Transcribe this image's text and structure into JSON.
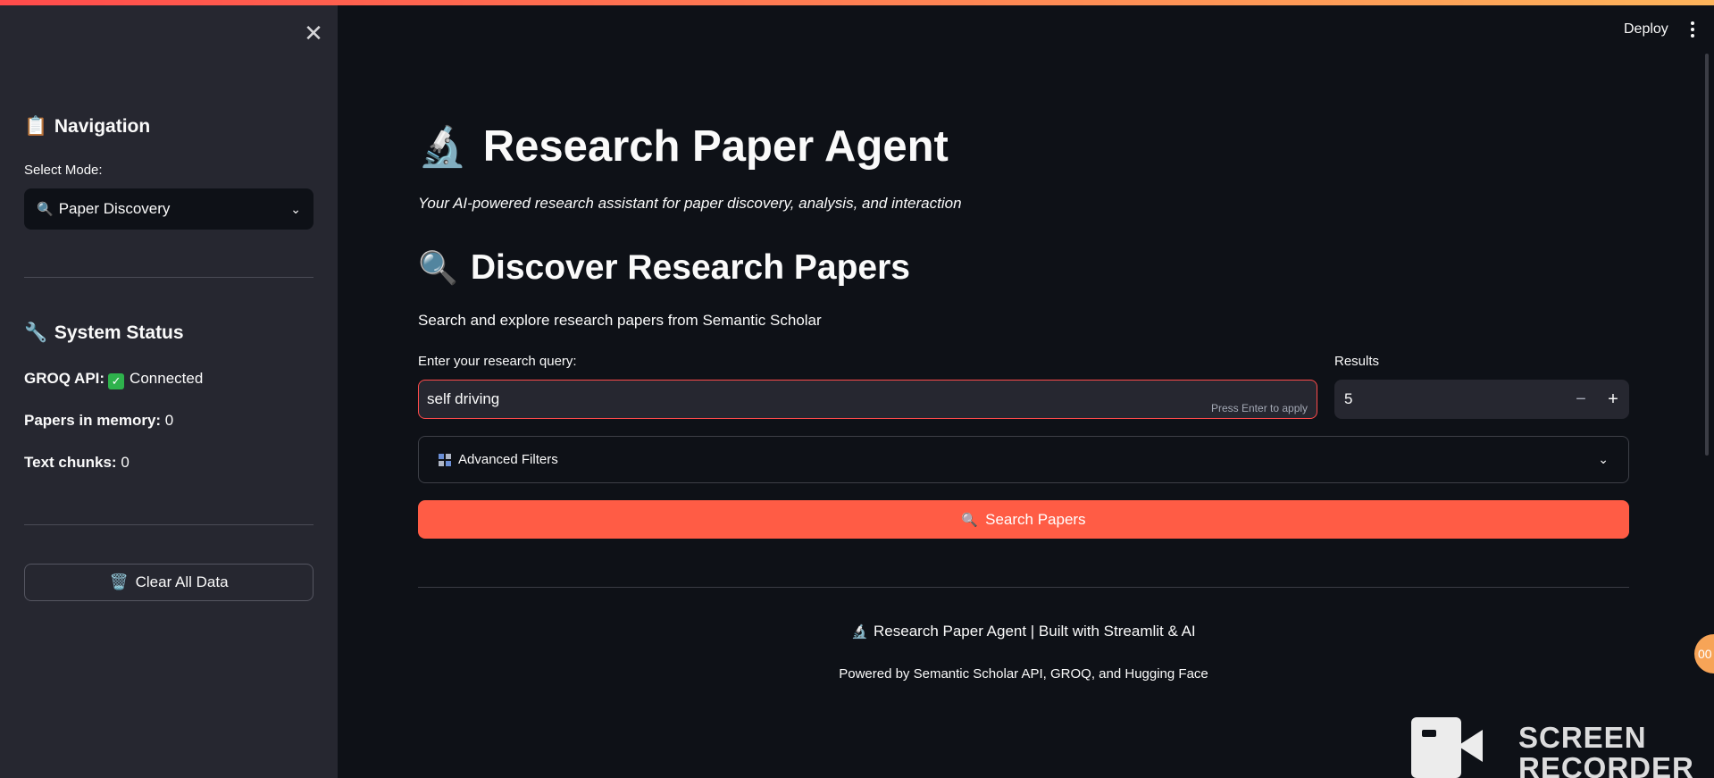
{
  "header": {
    "deploy_label": "Deploy",
    "menu_icon": "kebab-menu-icon"
  },
  "sidebar": {
    "close_icon": "close-icon",
    "close_glyph": "✕",
    "navigation": {
      "icon": "clipboard-icon",
      "icon_glyph": "📋",
      "title": "Navigation",
      "select_label": "Select Mode:",
      "selected_icon_glyph": "🔍",
      "selected_value": "Paper Discovery",
      "chevron_glyph": "⌄"
    },
    "system_status": {
      "icon": "wrench-icon",
      "icon_glyph": "🔧",
      "title": "System Status",
      "groq_label": "GROQ API:",
      "groq_value": "Connected",
      "papers_label": "Papers in memory:",
      "papers_value": "0",
      "chunks_label": "Text chunks:",
      "chunks_value": "0"
    },
    "clear_button": {
      "icon_glyph": "🗑️",
      "label": "Clear All Data"
    }
  },
  "main": {
    "title_icon_glyph": "🔬",
    "title": "Research Paper Agent",
    "subtitle": "Your AI-powered research assistant for paper discovery, analysis, and interaction",
    "section_icon_glyph": "🔍",
    "section_title": "Discover Research Papers",
    "section_desc": "Search and explore research papers from Semantic Scholar",
    "query": {
      "label": "Enter your research query:",
      "value": "self driving",
      "hint": "Press Enter to apply"
    },
    "results": {
      "label": "Results",
      "value": "5",
      "minus": "−",
      "plus": "+"
    },
    "advanced_filters": {
      "label": "Advanced Filters",
      "chevron_glyph": "⌄"
    },
    "search_button": {
      "icon_glyph": "🔍",
      "label": "Search Papers"
    }
  },
  "footer": {
    "line1_icon_glyph": "🔬",
    "line1": "Research Paper Agent | Built with Streamlit & AI",
    "line2": "Powered by Semantic Scholar API, GROQ, and Hugging Face"
  },
  "overlay": {
    "badge_text": "00",
    "watermark_line1": "SCREEN",
    "watermark_line2": "RECORDER"
  },
  "colors": {
    "accent": "#ff4b4b",
    "button": "#ff5c45",
    "background": "#0e1117",
    "sidebar": "#262730",
    "success": "#2eb24c"
  }
}
